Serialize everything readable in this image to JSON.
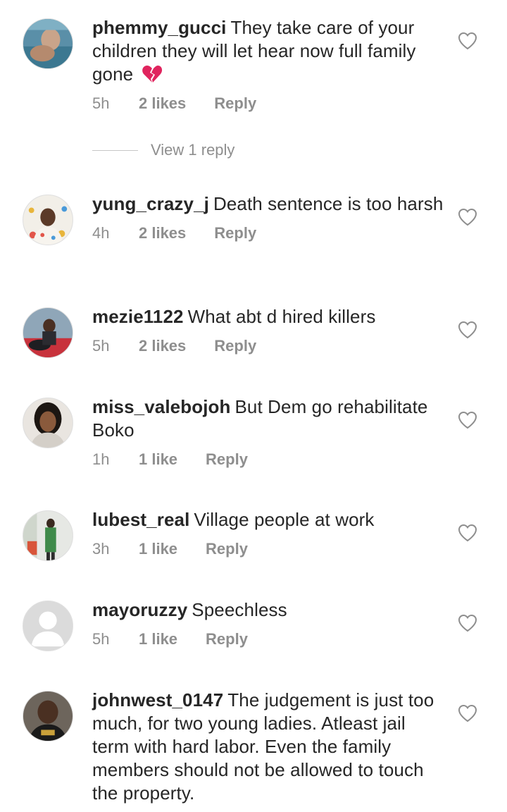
{
  "comments": [
    {
      "username": "phemmy_gucci",
      "text": "They take care of your children they will let hear now full family gone",
      "emoji": "broken-heart",
      "time": "5h",
      "likes": "2 likes",
      "reply": "Reply",
      "view_replies": "View 1 reply"
    },
    {
      "username": "yung_crazy_j",
      "text": "Death sentence is too harsh",
      "time": "4h",
      "likes": "2 likes",
      "reply": "Reply"
    },
    {
      "username": "mezie1122",
      "text": "What abt d hired killers",
      "time": "5h",
      "likes": "2 likes",
      "reply": "Reply"
    },
    {
      "username": "miss_valebojoh",
      "text": "But Dem go rehabilitate Boko",
      "time": "1h",
      "likes": "1 like",
      "reply": "Reply"
    },
    {
      "username": "lubest_real",
      "text": "Village people at work",
      "time": "3h",
      "likes": "1 like",
      "reply": "Reply"
    },
    {
      "username": "mayoruzzy",
      "text": "Speechless",
      "time": "5h",
      "likes": "1 like",
      "reply": "Reply"
    },
    {
      "username": "johnwest_0147",
      "text": "The judgement is just too much, for two young ladies. Atleast jail term with hard labor. Even the family members should not be allowed to touch the property."
    }
  ],
  "icons": {
    "like": "heart-outline-icon",
    "avatar_placeholder": "default-avatar-icon",
    "emoji": "broken-heart-emoji"
  },
  "colors": {
    "text": "#262626",
    "meta": "#8e8e8e",
    "heart_stroke": "#8e8e8e",
    "broken_heart": "#e0245e"
  }
}
